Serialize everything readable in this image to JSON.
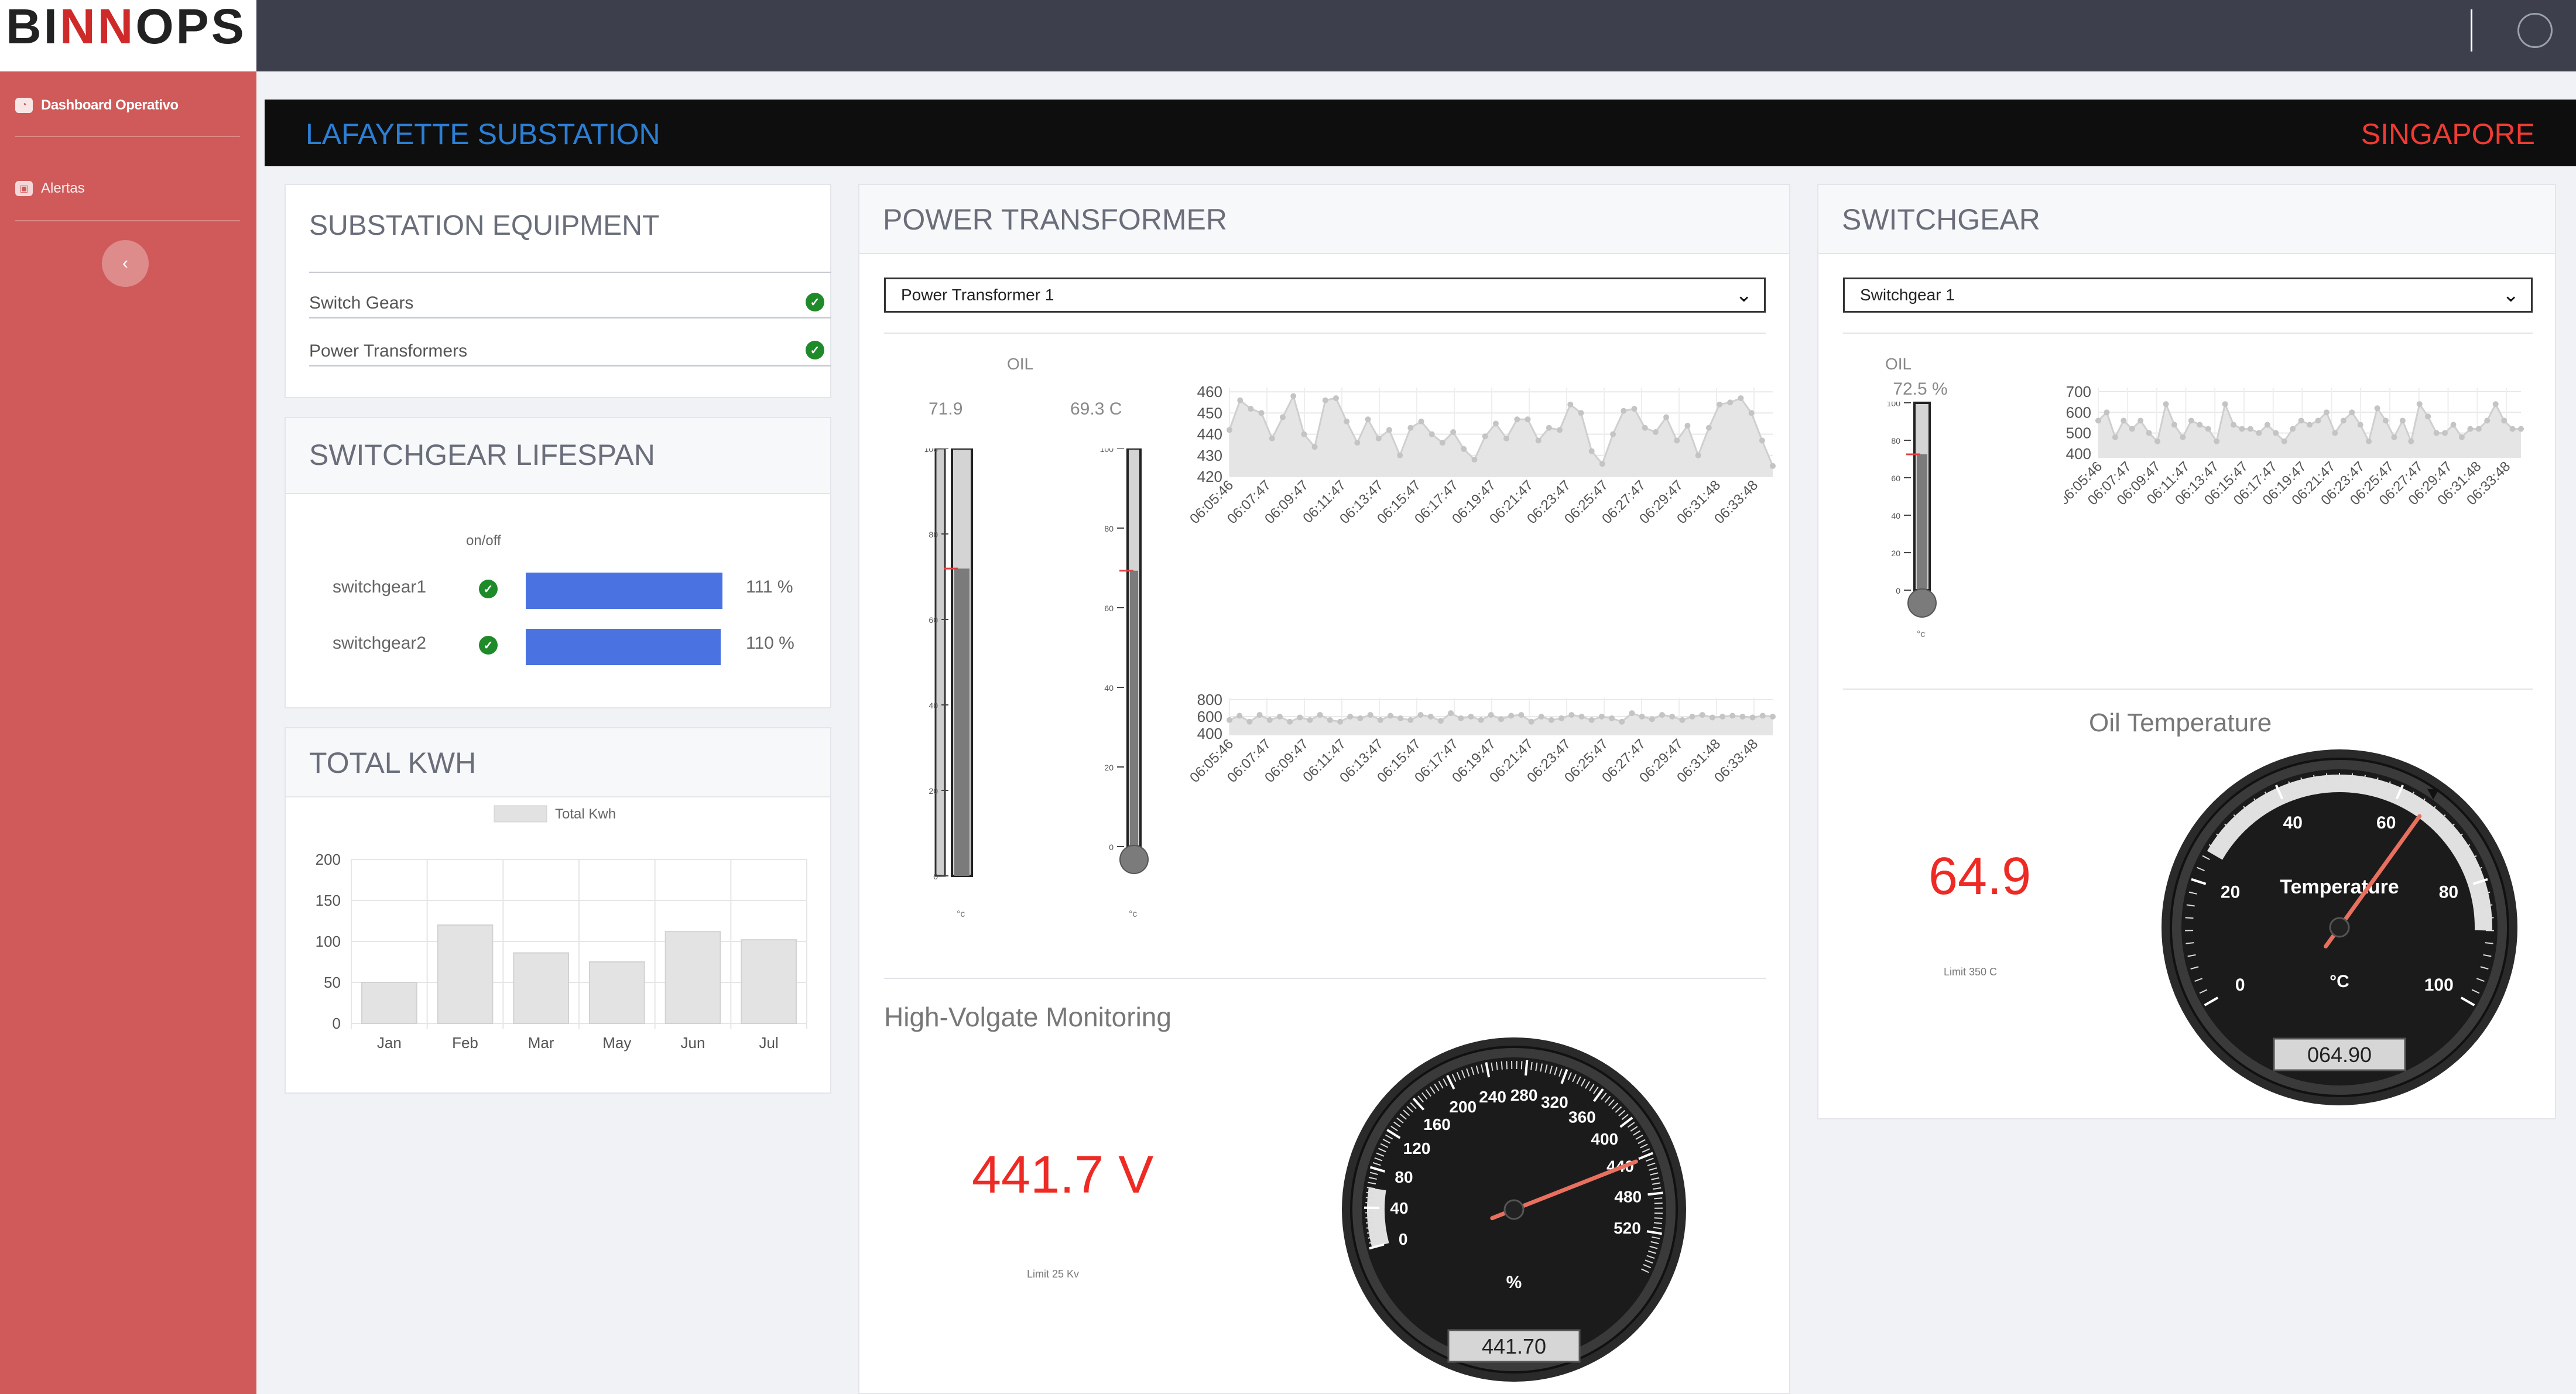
{
  "brand": {
    "logo_pre": "BI",
    "logo_mid": "NN",
    "logo_post": "OPS"
  },
  "sidebar": {
    "items": [
      {
        "label": "Dashboard Operativo"
      },
      {
        "label": "Alertas"
      }
    ]
  },
  "header": {
    "left": "LAFAYETTE SUBSTATION",
    "right": "SINGAPORE"
  },
  "equipment": {
    "title": "SUBSTATION EQUIPMENT",
    "rows": [
      {
        "label": "Switch Gears"
      },
      {
        "label": "Power Transformers"
      }
    ]
  },
  "lifespan": {
    "title": "SWITCHGEAR LIFESPAN",
    "col_header": "on/off",
    "rows": [
      {
        "label": "switchgear1",
        "value_label": "111 %",
        "value": 111
      },
      {
        "label": "switchgear2",
        "value_label": "110 %",
        "value": 110
      }
    ]
  },
  "kwh": {
    "title": "TOTAL KWH",
    "legend": "Total Kwh",
    "chart_data": {
      "type": "bar",
      "categories": [
        "Jan",
        "Feb",
        "Mar",
        "May",
        "Jun",
        "Jul"
      ],
      "values": [
        50,
        120,
        86,
        75,
        112,
        102
      ],
      "ylim": [
        0,
        200
      ],
      "yticks": [
        "0",
        "50",
        "100",
        "150",
        "200"
      ]
    }
  },
  "transformer": {
    "title": "POWER TRANSFORMER",
    "select": "Power Transformer 1",
    "oil_label": "OIL",
    "therm1_value": "71.9",
    "therm1_level": 71.9,
    "therm2_value": "69.3 C",
    "therm2_level": 69.3,
    "therm_ticks": [
      "100",
      "80",
      "60",
      "40",
      "20",
      "0"
    ],
    "therm_unit": "°c",
    "chart1": {
      "chart_data": {
        "type": "line",
        "yticks": [
          "460",
          "450",
          "440",
          "430",
          "420"
        ],
        "ylim": [
          420,
          462
        ],
        "x": [
          "06:05:46",
          "06:07:47",
          "06:09:47",
          "06:11:47",
          "06:13:47",
          "06:15:47",
          "06:17:47",
          "06:19:47",
          "06:21:47",
          "06:23:47",
          "06:25:47",
          "06:27:47",
          "06:29:47",
          "06:31:48",
          "06:33:48"
        ],
        "values": [
          442,
          456,
          452,
          450,
          438,
          448,
          458,
          440,
          434,
          456,
          457,
          446,
          436,
          447,
          438,
          442,
          430,
          443,
          446,
          440,
          436,
          441,
          433,
          428,
          439,
          445,
          438,
          447,
          447,
          437,
          443,
          442,
          454,
          450,
          432,
          426,
          440,
          451,
          452,
          443,
          441,
          448,
          437,
          444,
          430,
          443,
          454,
          455,
          457,
          450,
          437,
          425
        ]
      }
    },
    "chart2": {
      "chart_data": {
        "type": "line",
        "yticks": [
          "800",
          "600",
          "400"
        ],
        "ylim": [
          380,
          820
        ],
        "x": [
          "06:05:46",
          "06:07:47",
          "06:09:47",
          "06:11:47",
          "06:13:47",
          "06:15:47",
          "06:17:47",
          "06:19:47",
          "06:21:47",
          "06:23:47",
          "06:25:47",
          "06:27:47",
          "06:29:47",
          "06:31:48",
          "06:33:48"
        ],
        "values": [
          560,
          610,
          540,
          620,
          560,
          600,
          540,
          590,
          560,
          620,
          560,
          540,
          600,
          580,
          620,
          560,
          610,
          580,
          560,
          620,
          600,
          550,
          640,
          580,
          600,
          560,
          620,
          570,
          610,
          620,
          540,
          600,
          560,
          580,
          620,
          600,
          560,
          600,
          580,
          540,
          640,
          600,
          570,
          620,
          600,
          560,
          600,
          620,
          590,
          600,
          610,
          600,
          590,
          610,
          600
        ]
      }
    },
    "hv_title": "High-Volgate Monitoring",
    "hv_value": "441.7 V",
    "hv_limit": "Limit 25 Kv",
    "gauge_ticks": [
      "0",
      "40",
      "80",
      "120",
      "160",
      "200",
      "240",
      "280",
      "320",
      "360",
      "400",
      "440",
      "480",
      "520"
    ],
    "gauge_unit": "%",
    "gauge_value": 441.7,
    "gauge_readout": "441.70"
  },
  "switchgear": {
    "title": "SWITCHGEAR",
    "select": "Switchgear 1",
    "oil_label": "OIL",
    "oil_value": "72.5 %",
    "therm_level": 72.5,
    "therm_ticks": [
      "100",
      "80",
      "60",
      "40",
      "20",
      "0"
    ],
    "therm_unit": "°c",
    "chart": {
      "chart_data": {
        "type": "line",
        "yticks": [
          "700",
          "600",
          "500",
          "400"
        ],
        "ylim": [
          380,
          720
        ],
        "x": [
          "06:05:46",
          "06:07:47",
          "06:09:47",
          "06:11:47",
          "06:13:47",
          "06:15:47",
          "06:17:47",
          "06:19:47",
          "06:21:47",
          "06:23:47",
          "06:25:47",
          "06:27:47",
          "06:29:47",
          "06:31:48",
          "06:33:48"
        ],
        "values": [
          560,
          600,
          480,
          560,
          520,
          560,
          500,
          460,
          640,
          540,
          480,
          560,
          540,
          520,
          460,
          640,
          540,
          520,
          520,
          500,
          540,
          500,
          460,
          520,
          560,
          540,
          560,
          600,
          500,
          560,
          600,
          540,
          460,
          620,
          560,
          480,
          560,
          460,
          640,
          580,
          500,
          500,
          540,
          480,
          520,
          520,
          560,
          640,
          560,
          520,
          520
        ]
      }
    },
    "temp_title": "Oil Temperature",
    "temp_value": "64.9",
    "temp_limit": "Limit 350 C",
    "gauge_ticks": [
      "0",
      "20",
      "40",
      "60",
      "80",
      "100"
    ],
    "gauge_label": "Temperature",
    "gauge_unit": "°C",
    "gauge_value": 64.9,
    "gauge_readout": "064.90"
  }
}
